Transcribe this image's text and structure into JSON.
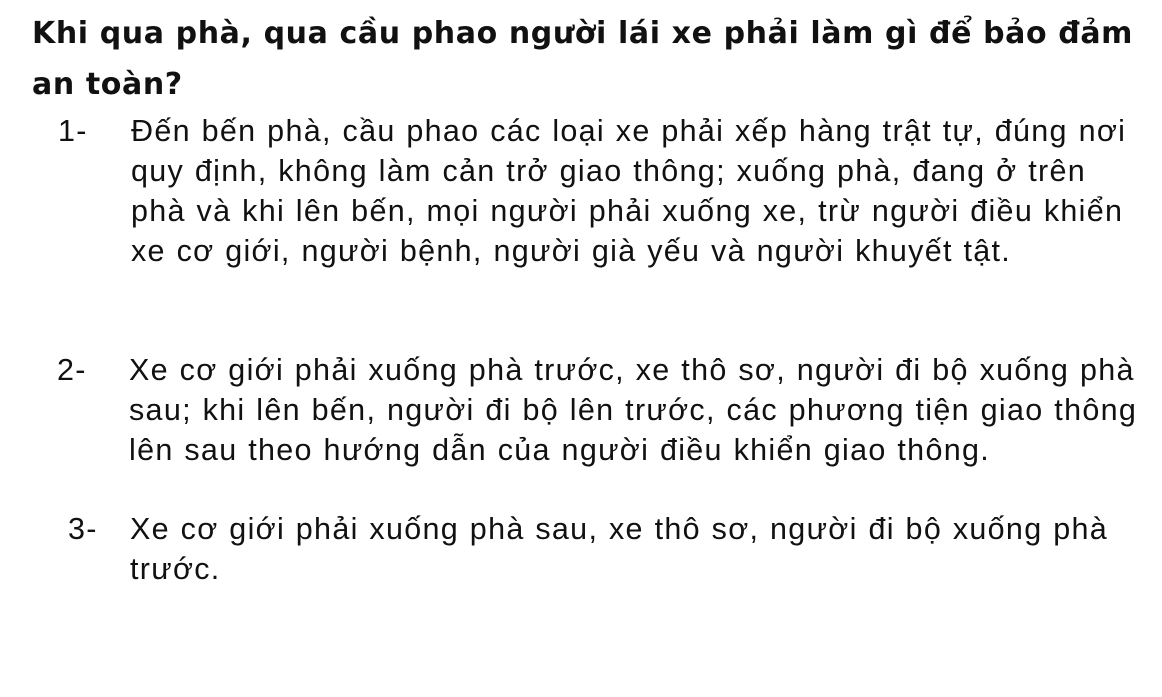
{
  "question": "Khi qua phà, qua cầu phao người lái xe phải làm gì để bảo đảm an toàn?",
  "answers": [
    {
      "number": "1-",
      "text": "Đến bến phà, cầu phao các loại xe phải xếp hàng trật tự, đúng nơi quy định, không làm cản trở giao thông; xuống phà, đang ở trên phà và khi lên bến, mọi người phải xuống xe, trừ người điều khiển xe cơ giới, người bệnh, người già yếu và người khuyết tật."
    },
    {
      "number": "2-",
      "text": "Xe cơ giới phải xuống phà trước, xe thô sơ, người đi bộ xuống phà sau; khi lên bến, người đi bộ lên trước, các phương tiện giao thông lên sau theo hướng dẫn của người điều khiển giao thông."
    },
    {
      "number": "3-",
      "text": "Xe cơ giới phải xuống phà sau, xe thô sơ, người đi bộ xuống phà trước."
    }
  ]
}
